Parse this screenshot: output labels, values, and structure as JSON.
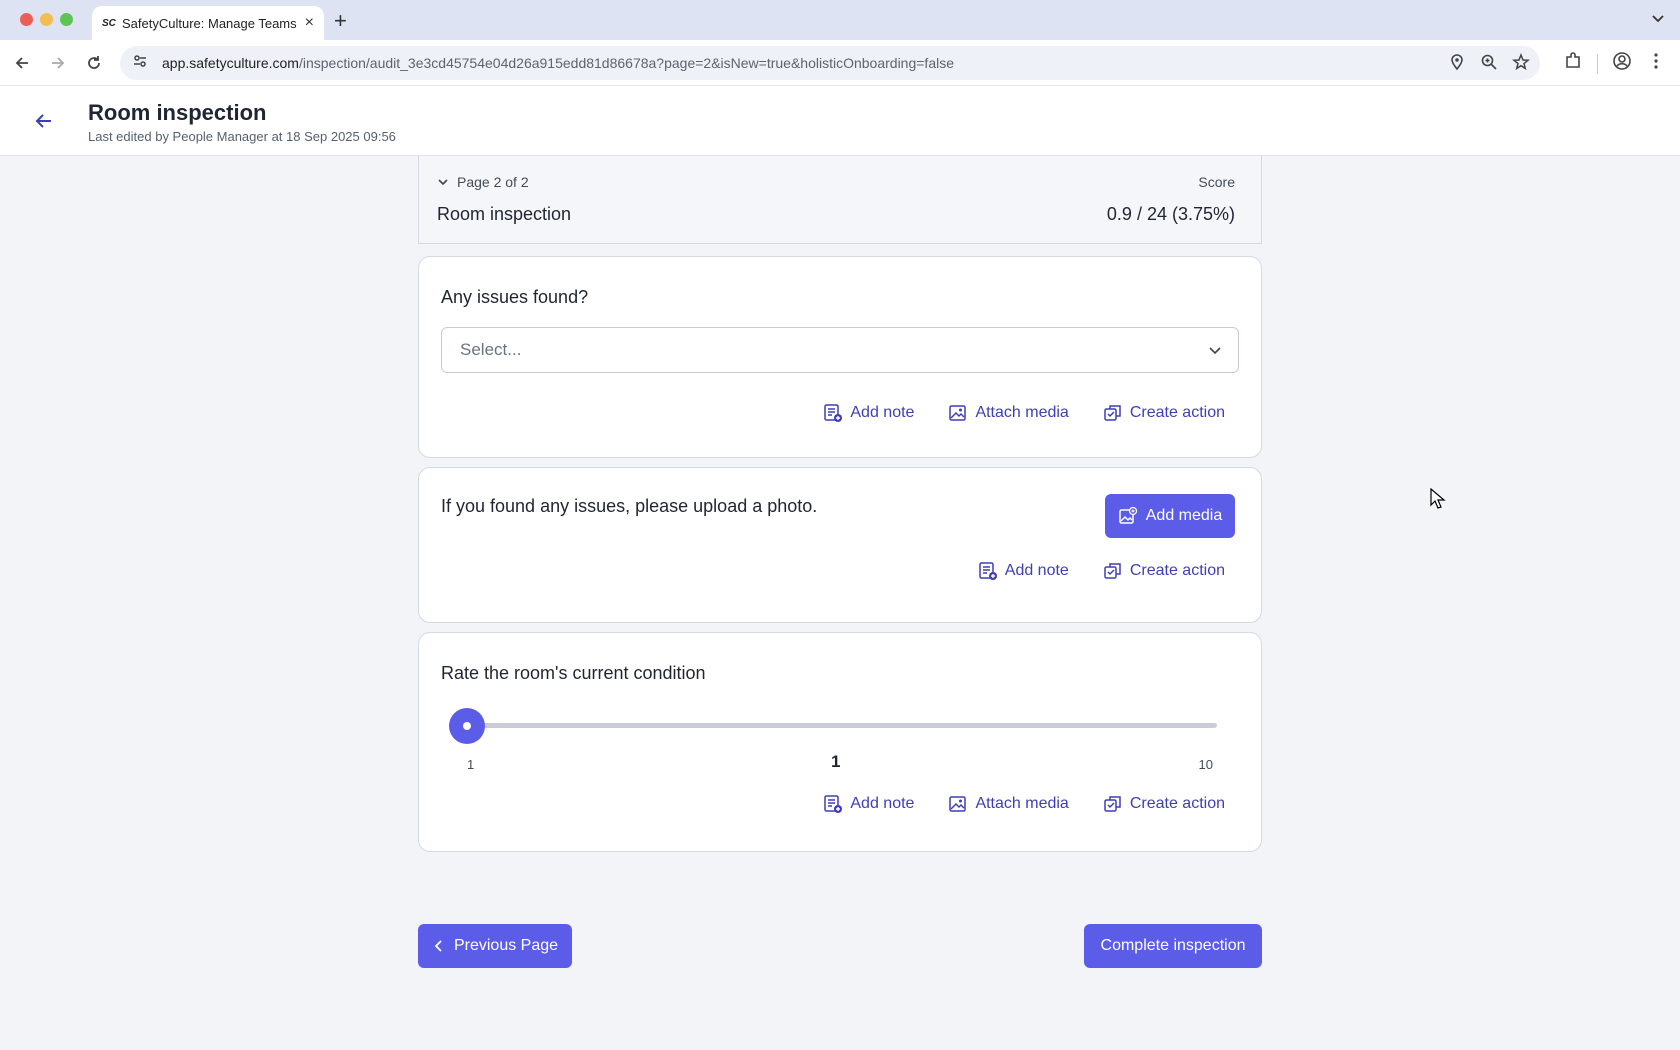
{
  "browser": {
    "tab_title": "SafetyCulture: Manage Teams",
    "tab_favicon": "SC",
    "url_host": "app.safetyculture.com",
    "url_path": "/inspection/audit_3e3cd45754e04d26a915edd81d86678a?page=2&isNew=true&holisticOnboarding=false",
    "icons": [
      "back-icon",
      "forward-icon",
      "reload-icon",
      "site-info-icon",
      "location-icon",
      "zoom-icon",
      "bookmark-star-icon",
      "extensions-icon",
      "profile-icon",
      "menu-icon"
    ]
  },
  "header": {
    "title": "Room inspection",
    "subtitle": "Last edited by People Manager at 18 Sep 2025 09:56"
  },
  "page_header": {
    "page_indicator": "Page 2 of 2",
    "score_label": "Score",
    "section_title": "Room inspection",
    "score_value": "0.9 / 24 (3.75%)"
  },
  "questions": {
    "q1": {
      "label": "Any issues found?",
      "placeholder": "Select...",
      "add_note": "Add note",
      "attach_media": "Attach media",
      "create_action": "Create action"
    },
    "q2": {
      "label": "If you found any issues, please upload a photo.",
      "add_media": "Add media",
      "add_note": "Add note",
      "create_action": "Create action"
    },
    "q3": {
      "label": "Rate the room's current condition",
      "slider_min": "1",
      "slider_max": "10",
      "slider_value": "1",
      "slider_fraction": 0,
      "add_note": "Add note",
      "attach_media": "Attach media",
      "create_action": "Create action"
    }
  },
  "footer": {
    "previous_page": "Previous Page",
    "complete": "Complete inspection"
  },
  "colors": {
    "accent": "#5b5ce8",
    "link": "#3e3fb6"
  }
}
